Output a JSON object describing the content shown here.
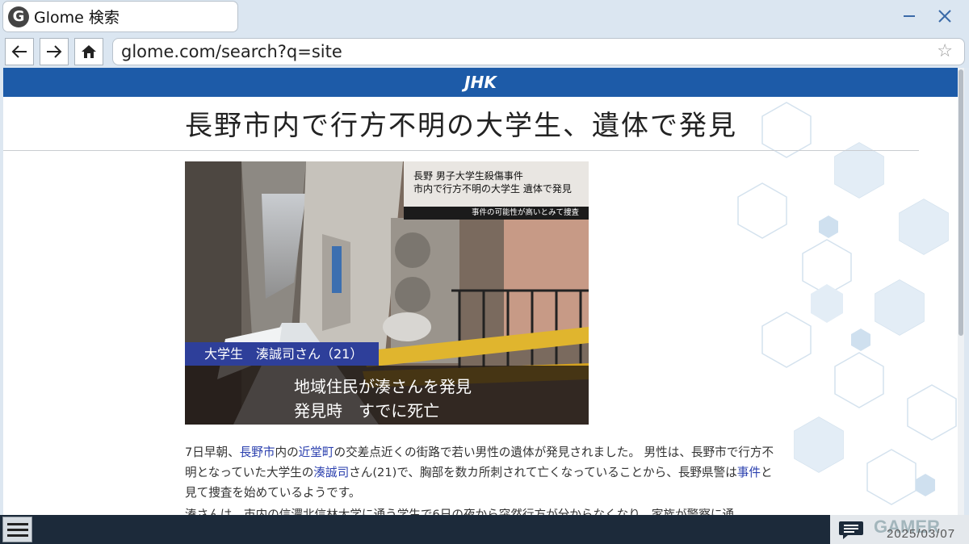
{
  "tab": {
    "logo_letter": "G",
    "title": "Glome 検索"
  },
  "window": {
    "minimize_icon": "minimize-icon",
    "close_icon": "close-icon"
  },
  "nav": {
    "back_icon": "back-arrow-icon",
    "forward_icon": "forward-arrow-icon",
    "home_icon": "home-icon",
    "url": "glome.com/search?q=site",
    "bookmark_icon": "star-icon"
  },
  "page": {
    "brand": "JHK",
    "headline": "長野市内で行方不明の大学生、遺体で発見",
    "image": {
      "caption_line1": "長野 男子大学生殺傷事件",
      "caption_line2": "市内で行方不明の大学生 遺体で発見",
      "caption_sub": "事件の可能性が高いとみて捜査",
      "name_tag": "大学生　湊誠司さん（21）",
      "lower_line1": "地域住民が湊さんを発見",
      "lower_line2": "発見時　すでに死亡"
    },
    "article": {
      "p1_a": "7日早朝、",
      "link_nagano": "長野市",
      "p1_b": "内の",
      "link_kondo": "近堂町",
      "p1_c": "の交差点近くの街路で若い男性の遺体が発見されました。 男性は、長野市で行方不明となっていた大学生の",
      "link_minato": "湊誠司",
      "p1_d": "さん(21)で、胸部を数カ所刺されて亡くなっていることから、長野県警は",
      "link_jiken": "事件",
      "p1_e": "と見て捜査を始めているようです。",
      "p2_partial": "湊さんは、市内の信濃北信林大学に通う学生で6日の夜から突然行方が分からなくなり、家族が警察に通"
    }
  },
  "taskbar": {
    "menu_icon": "hamburger-menu-icon",
    "chat_icon": "chat-bubble-icon",
    "watermark": "GAMER",
    "date": "2025/03/07"
  }
}
